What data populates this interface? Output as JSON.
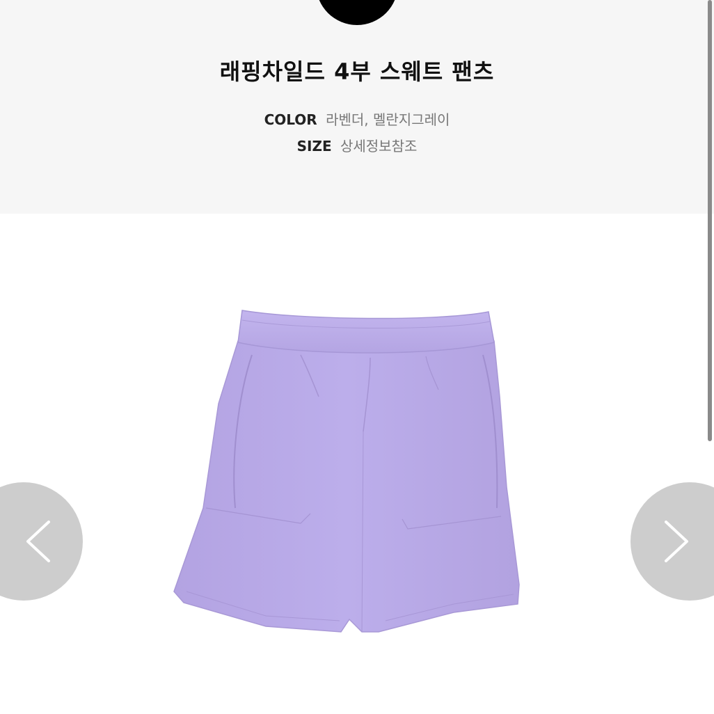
{
  "header": {
    "logo_icon": "brand-logo-circle"
  },
  "product": {
    "title": "래핑차일드 4부 스웨트 팬츠",
    "color_label": "COLOR",
    "color_value": "라벤더, 멜란지그레이",
    "size_label": "SIZE",
    "size_value": "상세정보참조",
    "image_icon": "lavender-sweat-shorts-image",
    "image_color": "#b8a8e6"
  },
  "carousel": {
    "prev_icon": "chevron-left-icon",
    "next_icon": "chevron-right-icon"
  },
  "colors": {
    "header_bg": "#f6f6f6",
    "arrow_bg": "#c4c4c4",
    "garment": "#b8a8e6"
  }
}
